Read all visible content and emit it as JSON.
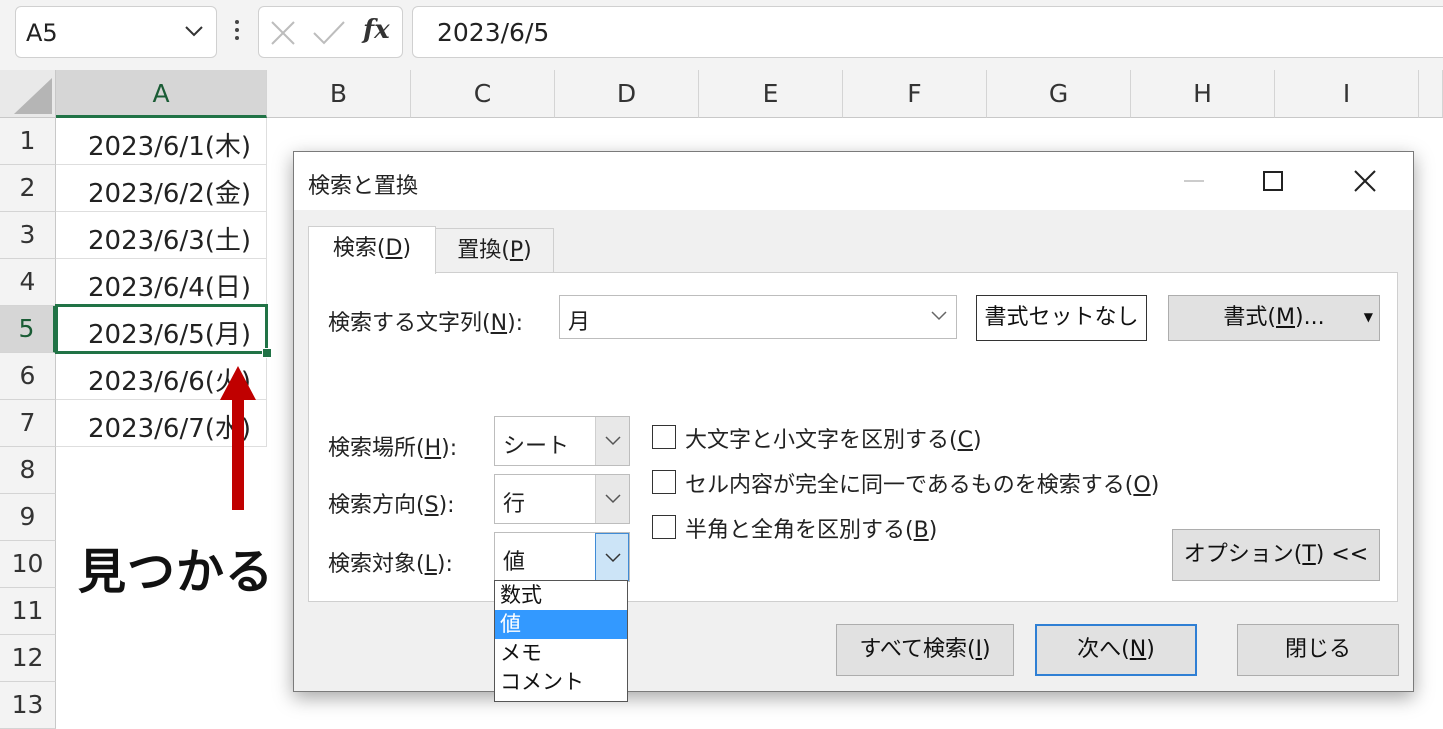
{
  "formula_bar": {
    "name_box": "A5",
    "formula": "2023/6/5",
    "fx": "fx"
  },
  "columns": [
    "A",
    "B",
    "C",
    "D",
    "E",
    "F",
    "G",
    "H",
    "I"
  ],
  "rows": [
    "1",
    "2",
    "3",
    "4",
    "5",
    "6",
    "7",
    "8",
    "9",
    "10",
    "11",
    "12",
    "13"
  ],
  "cells": {
    "A1": "2023/6/1(木)",
    "A2": "2023/6/2(金)",
    "A3": "2023/6/3(土)",
    "A4": "2023/6/4(日)",
    "A5": "2023/6/5(月)",
    "A6": "2023/6/6(火)",
    "A7": "2023/6/7(水)"
  },
  "selection": {
    "cell": "A5",
    "color": "#217346"
  },
  "annotation": {
    "label": "見つかる",
    "arrow_color": "#c00000"
  },
  "dialog": {
    "title": "検索と置換",
    "tabs": [
      {
        "label": "検索(",
        "key": "D",
        "close": ")"
      },
      {
        "label": "置換(",
        "key": "P",
        "close": ")"
      }
    ],
    "search_label": {
      "text": "検索する文字列(",
      "key": "N",
      "close": "):"
    },
    "search_value": "月",
    "no_format_button": "書式セットなし",
    "format_button": {
      "text": "書式(",
      "key": "M",
      "close": ")..."
    },
    "within": {
      "label": "検索場所(",
      "key": "H",
      "close": "):",
      "value": "シート"
    },
    "direction": {
      "label": "検索方向(",
      "key": "S",
      "close": "):",
      "value": "行"
    },
    "look_in": {
      "label": "検索対象(",
      "key": "L",
      "close": "):",
      "value": "値"
    },
    "look_in_options": [
      "数式",
      "値",
      "メモ",
      "コメント"
    ],
    "checkboxes": [
      {
        "label": "大文字と小文字を区別する(",
        "key": "C",
        "close": ")",
        "checked": false
      },
      {
        "label": "セル内容が完全に同一であるものを検索する(",
        "key": "O",
        "close": ")",
        "checked": false
      },
      {
        "label": "半角と全角を区別する(",
        "key": "B",
        "close": ")",
        "checked": false
      }
    ],
    "options_button": {
      "text": "オプション(",
      "key": "T",
      "close": ") <<"
    },
    "find_all_button": {
      "text": "すべて検索(",
      "key": "I",
      "close": ")"
    },
    "find_next_button": {
      "text": "次へ(",
      "key": "N",
      "close": ")"
    },
    "close_button": "閉じる"
  }
}
